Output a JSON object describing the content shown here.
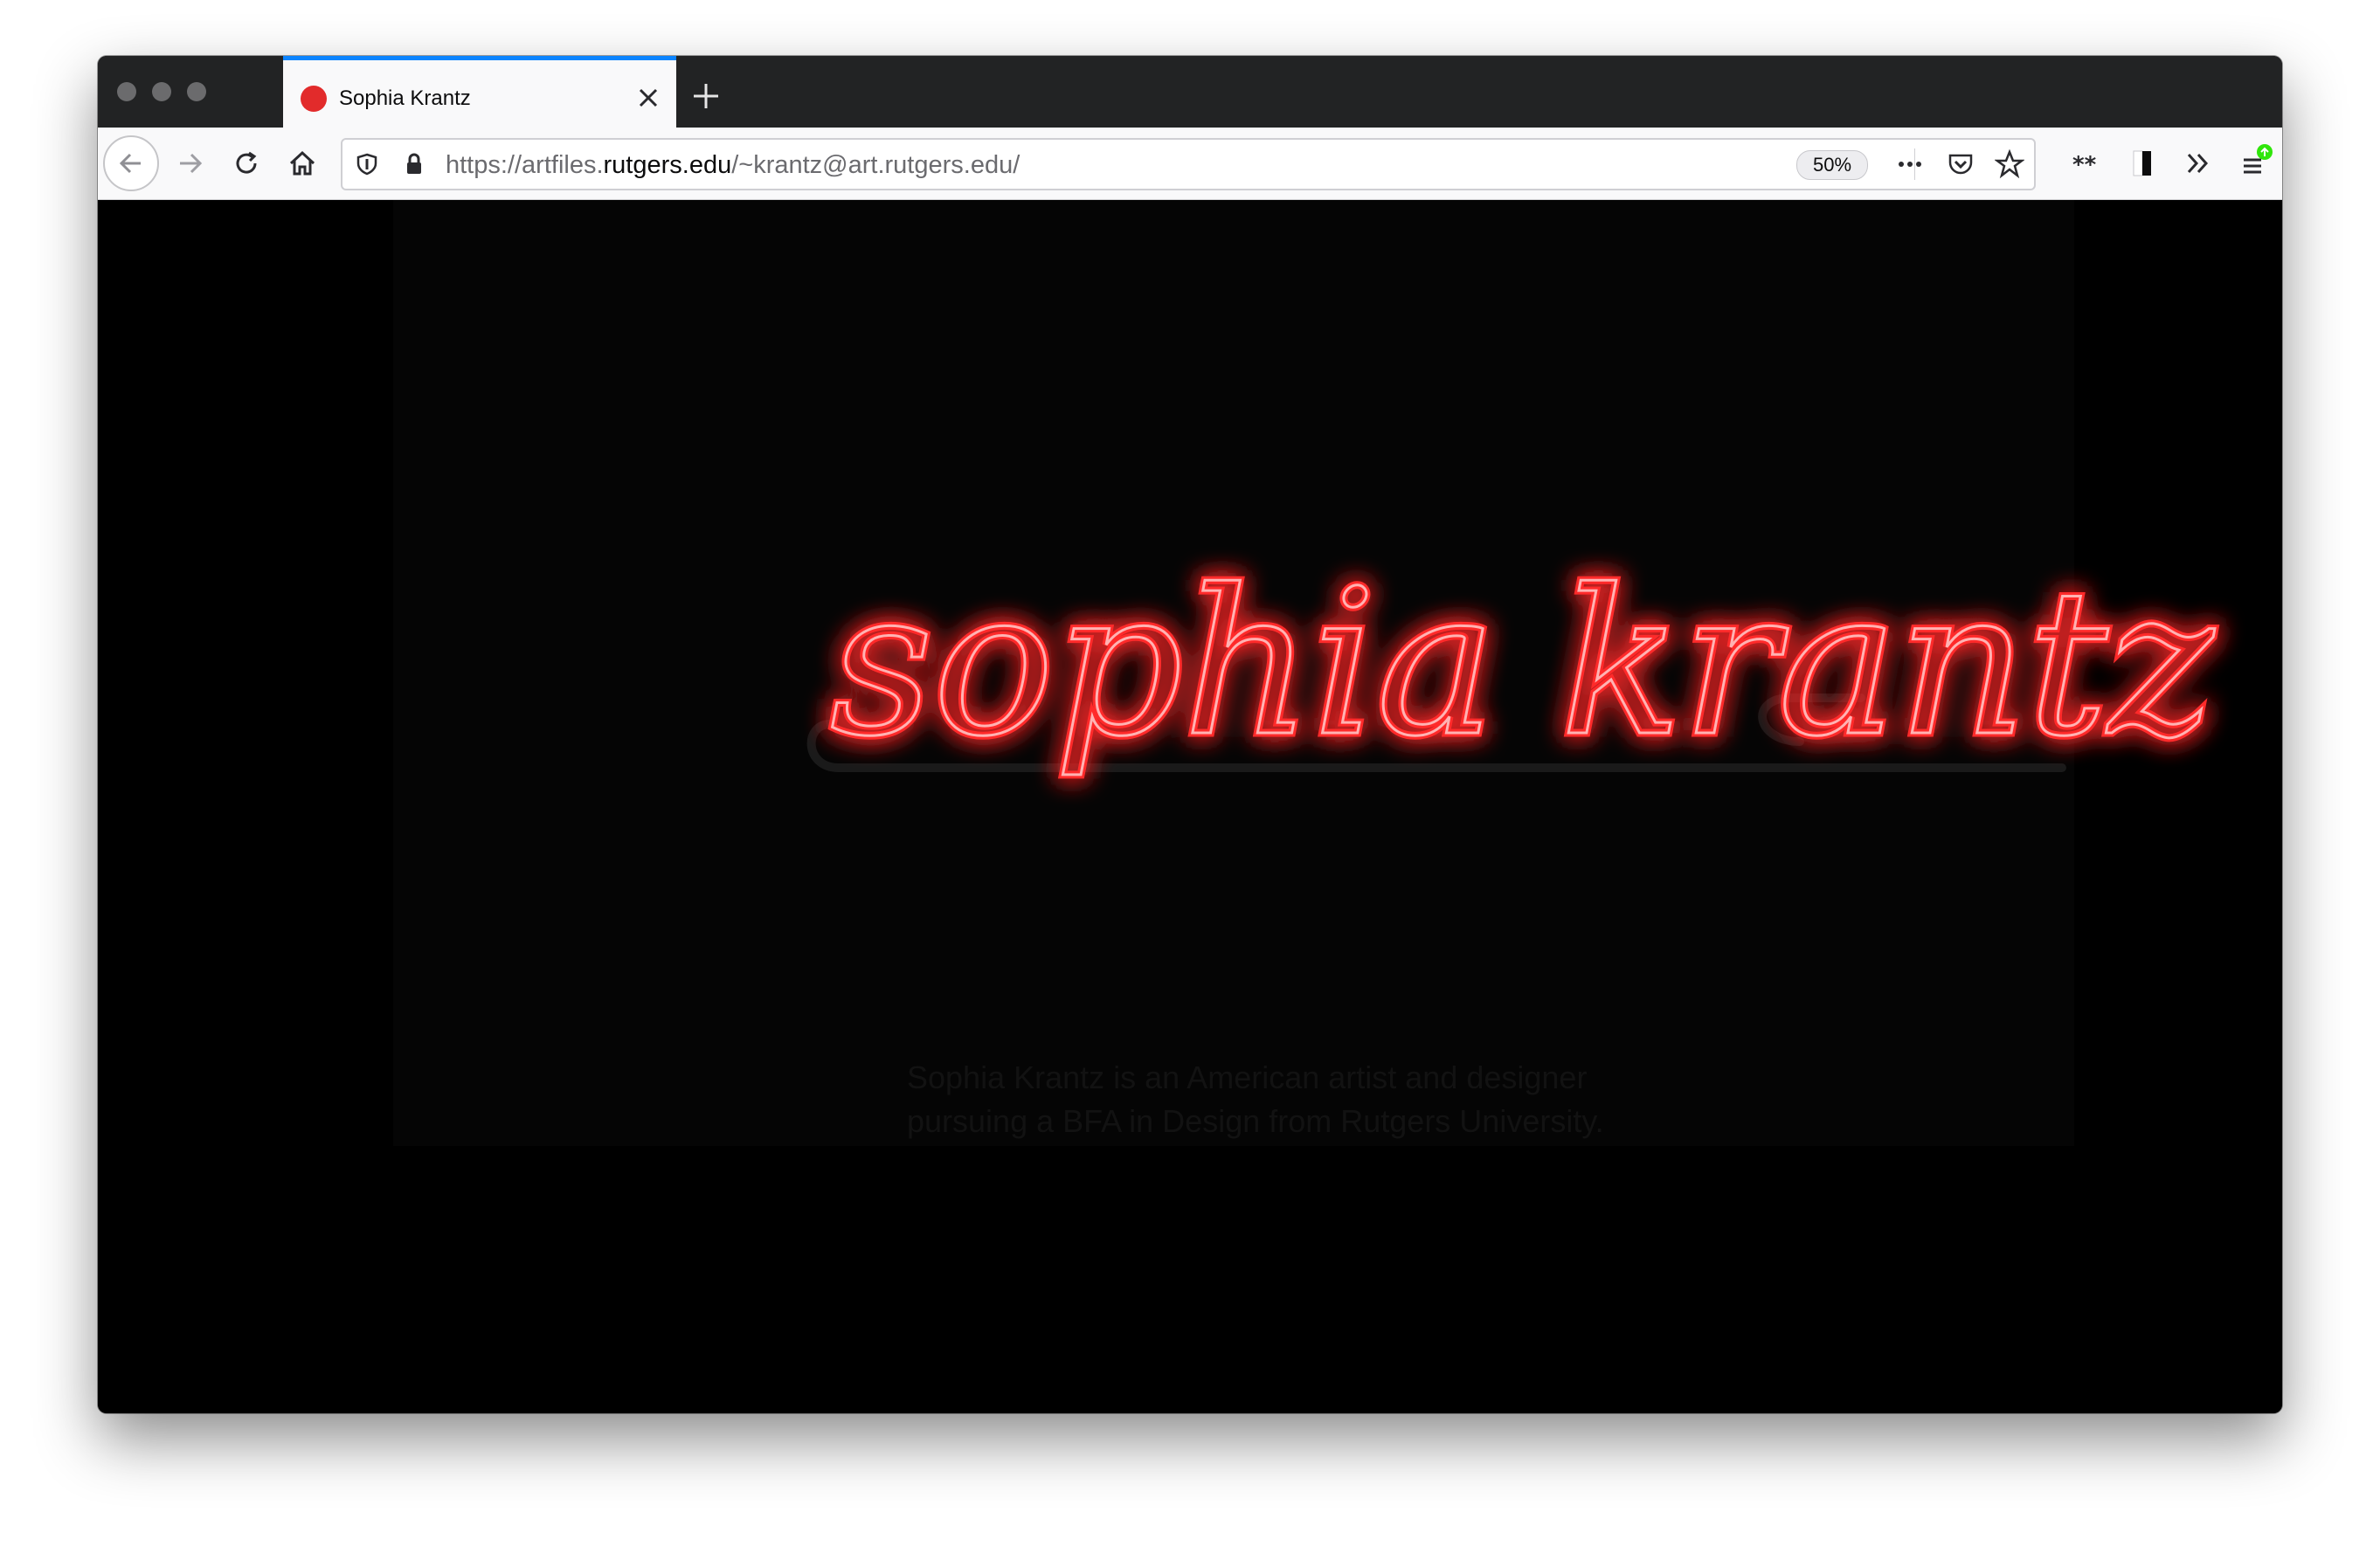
{
  "tab": {
    "title": "Sophia Krantz",
    "favicon_color": "#e22b2b",
    "accent_color": "#0a84ff"
  },
  "toolbar": {
    "url_prefix": "https://artfiles.",
    "url_host": "rutgers.edu",
    "url_suffix": "/~krantz@art.rutgers.edu/",
    "zoom": "50%",
    "icons": [
      "back-icon",
      "forward-icon",
      "reload-icon",
      "home-icon",
      "shield-icon",
      "lock-icon",
      "page-actions-icon",
      "pocket-icon",
      "bookmark-star-icon",
      "extension-icon",
      "reader-mode-icon",
      "overflow-icon",
      "menu-icon"
    ]
  },
  "page": {
    "logo_text": "sophia krantz",
    "neon_color": "#ff3b3b",
    "bio_line_1": "Sophia Krantz is an American artist and designer",
    "bio_line_2": "pursuing a BFA in Design from Rutgers University."
  }
}
